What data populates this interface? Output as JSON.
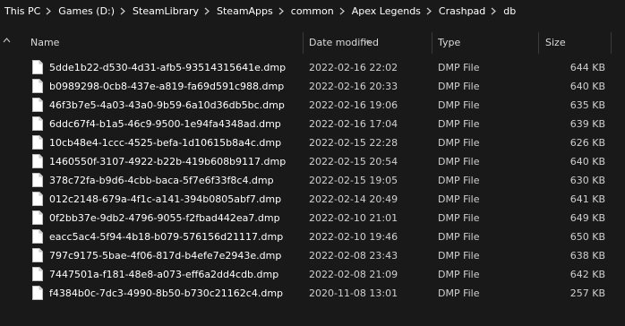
{
  "breadcrumb": {
    "items": [
      "This PC",
      "Games (D:)",
      "SteamLibrary",
      "SteamApps",
      "common",
      "Apex Legends",
      "Crashpad",
      "db"
    ]
  },
  "columns": {
    "name": "Name",
    "date": "Date modified",
    "type": "Type",
    "size": "Size"
  },
  "icons": {
    "file": "file-icon",
    "separator": "chevron-right-icon",
    "sort": "sort-up-icon",
    "collapse": "chevron-up-icon"
  },
  "colors": {
    "background": "#191919",
    "text": "#ffffff",
    "muted_text": "#d0d0d0",
    "divider": "#3a3a3a"
  },
  "files": [
    {
      "name": "5dde1b22-d530-4d31-afb5-93514315641e.dmp",
      "date": "2022-02-16 22:02",
      "type": "DMP File",
      "size": "644 KB"
    },
    {
      "name": "b0989298-0cb8-437e-a819-fa69d591c988.dmp",
      "date": "2022-02-16 20:33",
      "type": "DMP File",
      "size": "640 KB"
    },
    {
      "name": "46f3b7e5-4a03-43a0-9b59-6a10d36db5bc.dmp",
      "date": "2022-02-16 19:06",
      "type": "DMP File",
      "size": "635 KB"
    },
    {
      "name": "6ddc67f4-b1a5-46c9-9500-1e94fa4348ad.dmp",
      "date": "2022-02-16 17:04",
      "type": "DMP File",
      "size": "639 KB"
    },
    {
      "name": "10cb48e4-1ccc-4525-befa-1d10615b8a4c.dmp",
      "date": "2022-02-15 22:28",
      "type": "DMP File",
      "size": "626 KB"
    },
    {
      "name": "1460550f-3107-4922-b22b-419b608b9117.dmp",
      "date": "2022-02-15 20:54",
      "type": "DMP File",
      "size": "640 KB"
    },
    {
      "name": "378c72fa-b9d6-4cbb-baca-5f7e6f33f8c4.dmp",
      "date": "2022-02-15 19:05",
      "type": "DMP File",
      "size": "630 KB"
    },
    {
      "name": "012c2148-679a-4f1c-a141-394b0805abf7.dmp",
      "date": "2022-02-14 20:49",
      "type": "DMP File",
      "size": "641 KB"
    },
    {
      "name": "0f2bb37e-9db2-4796-9055-f2fbad442ea7.dmp",
      "date": "2022-02-10 21:01",
      "type": "DMP File",
      "size": "649 KB"
    },
    {
      "name": "eacc5ac4-5f94-4b18-b079-576156d21117.dmp",
      "date": "2022-02-10 19:46",
      "type": "DMP File",
      "size": "650 KB"
    },
    {
      "name": "797c9175-5bae-4f06-817d-b4efe7e2943e.dmp",
      "date": "2022-02-08 23:43",
      "type": "DMP File",
      "size": "638 KB"
    },
    {
      "name": "7447501a-f181-48e8-a073-eff6a2dd4cdb.dmp",
      "date": "2022-02-08 21:09",
      "type": "DMP File",
      "size": "642 KB"
    },
    {
      "name": "f4384b0c-7dc3-4990-8b50-b730c21162c4.dmp",
      "date": "2020-11-08 13:01",
      "type": "DMP File",
      "size": "257 KB"
    }
  ]
}
